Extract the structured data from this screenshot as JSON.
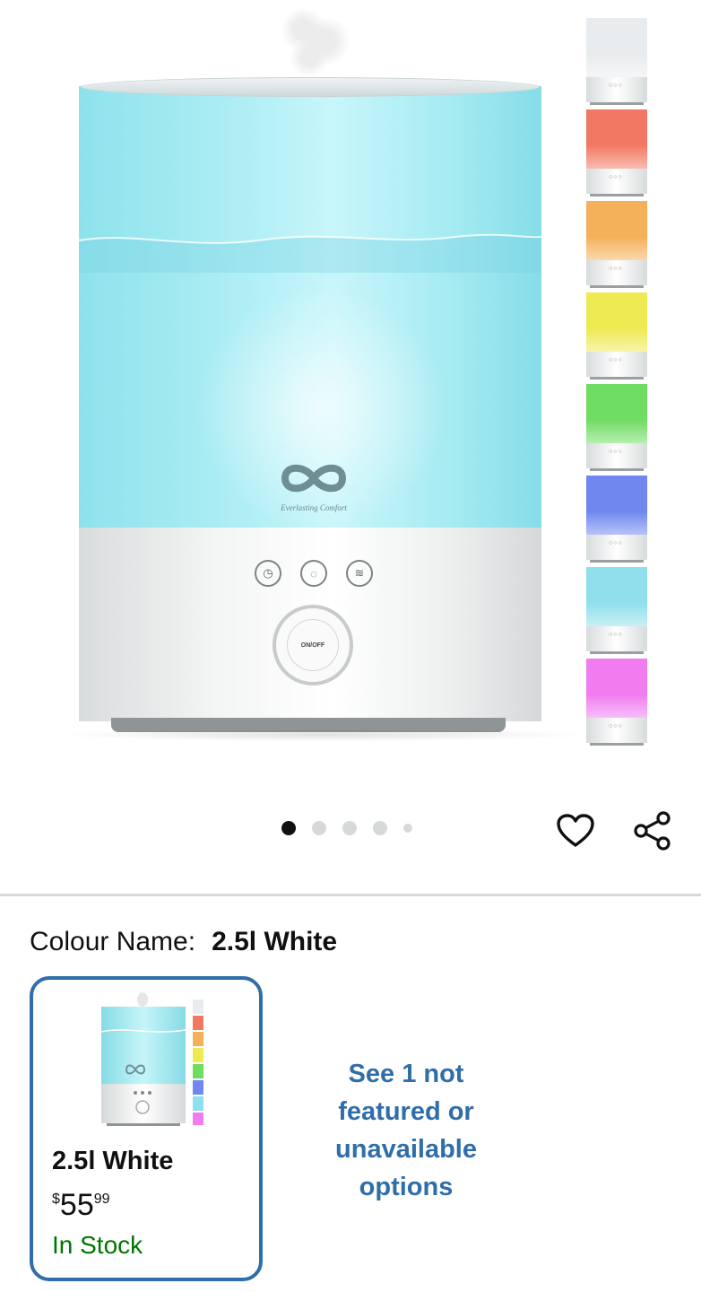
{
  "product_image": {
    "logo_text": "Everlasting Comfort",
    "dial_label": "ON/OFF",
    "swatch_colors": [
      "#e9ecee",
      "#f27863",
      "#f5b05a",
      "#eeea52",
      "#6fdc62",
      "#6f87ee",
      "#8fe0ec",
      "#f07cf0"
    ]
  },
  "carousel": {
    "dot_count": 5,
    "active_index": 0
  },
  "actions": {
    "wishlist_icon": "heart-icon",
    "share_icon": "share-icon"
  },
  "variation": {
    "label": "Colour Name:",
    "selected_value": "2.5l White",
    "options": [
      {
        "title": "2.5l White",
        "price_symbol": "$",
        "price_whole": "55",
        "price_fraction": "99",
        "availability": "In Stock"
      }
    ],
    "see_more_text": "See 1 not featured or unavailable options"
  },
  "colors": {
    "link_blue": "#2f6ea8",
    "in_stock_green": "#007600",
    "divider": "#d5d9d9"
  }
}
